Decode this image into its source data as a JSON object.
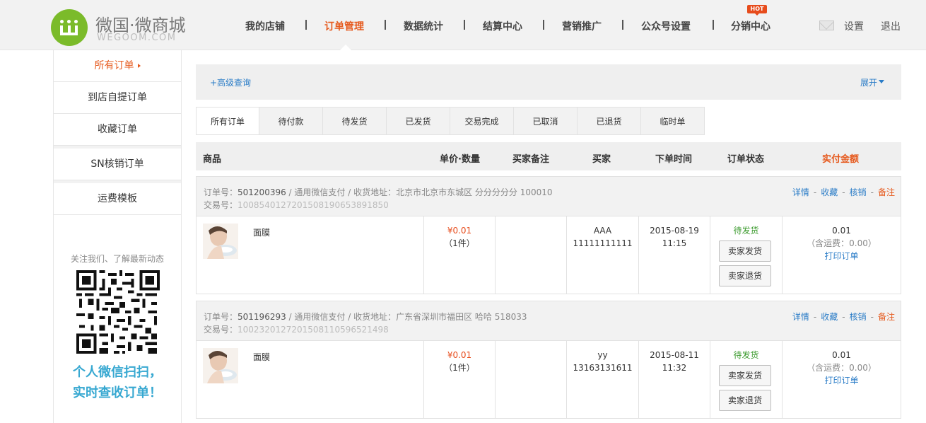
{
  "header": {
    "brand_cn": "微国·微商城",
    "brand_en": "WEGOOM.COM",
    "nav": [
      "我的店铺",
      "订单管理",
      "数据统计",
      "结算中心",
      "营销推广",
      "公众号设置",
      "分销中心"
    ],
    "hot_badge": "HOT",
    "settings": "设置",
    "logout": "退出"
  },
  "sidebar": {
    "items": [
      "所有订单",
      "到店自提订单",
      "收藏订单",
      "SN核销订单",
      "运费模板"
    ],
    "follow_text": "关注我们、了解最新动态",
    "promo_line1": "个人微信扫扫，",
    "promo_line2": "实时查收订单！"
  },
  "search": {
    "advanced": "+高级查询",
    "expand": "展开"
  },
  "tabs": [
    "所有订单",
    "待付款",
    "待发货",
    "已发货",
    "交易完成",
    "已取消",
    "已退货",
    "临时单"
  ],
  "table_headers": [
    "商品",
    "单价·数量",
    "买家备注",
    "买家",
    "下单时间",
    "订单状态",
    "实付金额"
  ],
  "orders": [
    {
      "order_label": "订单号：",
      "order_no": "501200396",
      "info": " / 通用微信支付 / 收货地址：北京市北京市东城区 分分分分分 100010",
      "txn_label": "交易号：",
      "txn_no": "1008540127201508190653891850",
      "actions": [
        "详情",
        "收藏",
        "核销",
        "备注"
      ],
      "product": "面膜",
      "price": "¥0.01",
      "qty": "（1件）",
      "buyer_name": "AAA",
      "buyer_phone": "11111111111",
      "date": "2015-08-19",
      "time": "11:15",
      "status": "待发货",
      "btn_ship": "卖家发货",
      "btn_return": "卖家退货",
      "amount": "0.01",
      "shipping": "（含运费：0.00）",
      "print": "打印订单"
    },
    {
      "order_label": "订单号：",
      "order_no": "501196293",
      "info": " / 通用微信支付 / 收货地址：广东省深圳市福田区 哈哈 518033",
      "txn_label": "交易号：",
      "txn_no": "1002320127201508110596521498",
      "actions": [
        "详情",
        "收藏",
        "核销",
        "备注"
      ],
      "product": "面膜",
      "price": "¥0.01",
      "qty": "（1件）",
      "buyer_name": "yy",
      "buyer_phone": "13163131611",
      "date": "2015-08-11",
      "time": "11:32",
      "status": "待发货",
      "btn_ship": "卖家发货",
      "btn_return": "卖家退货",
      "amount": "0.01",
      "shipping": "（含运费：0.00）",
      "print": "打印订单"
    }
  ],
  "colors": {
    "accent": "#e65a1e",
    "link": "#2a7cc7",
    "brand_green": "#7bbb2a",
    "status_green": "#3a9a2c",
    "promo_blue": "#37a8d1"
  }
}
